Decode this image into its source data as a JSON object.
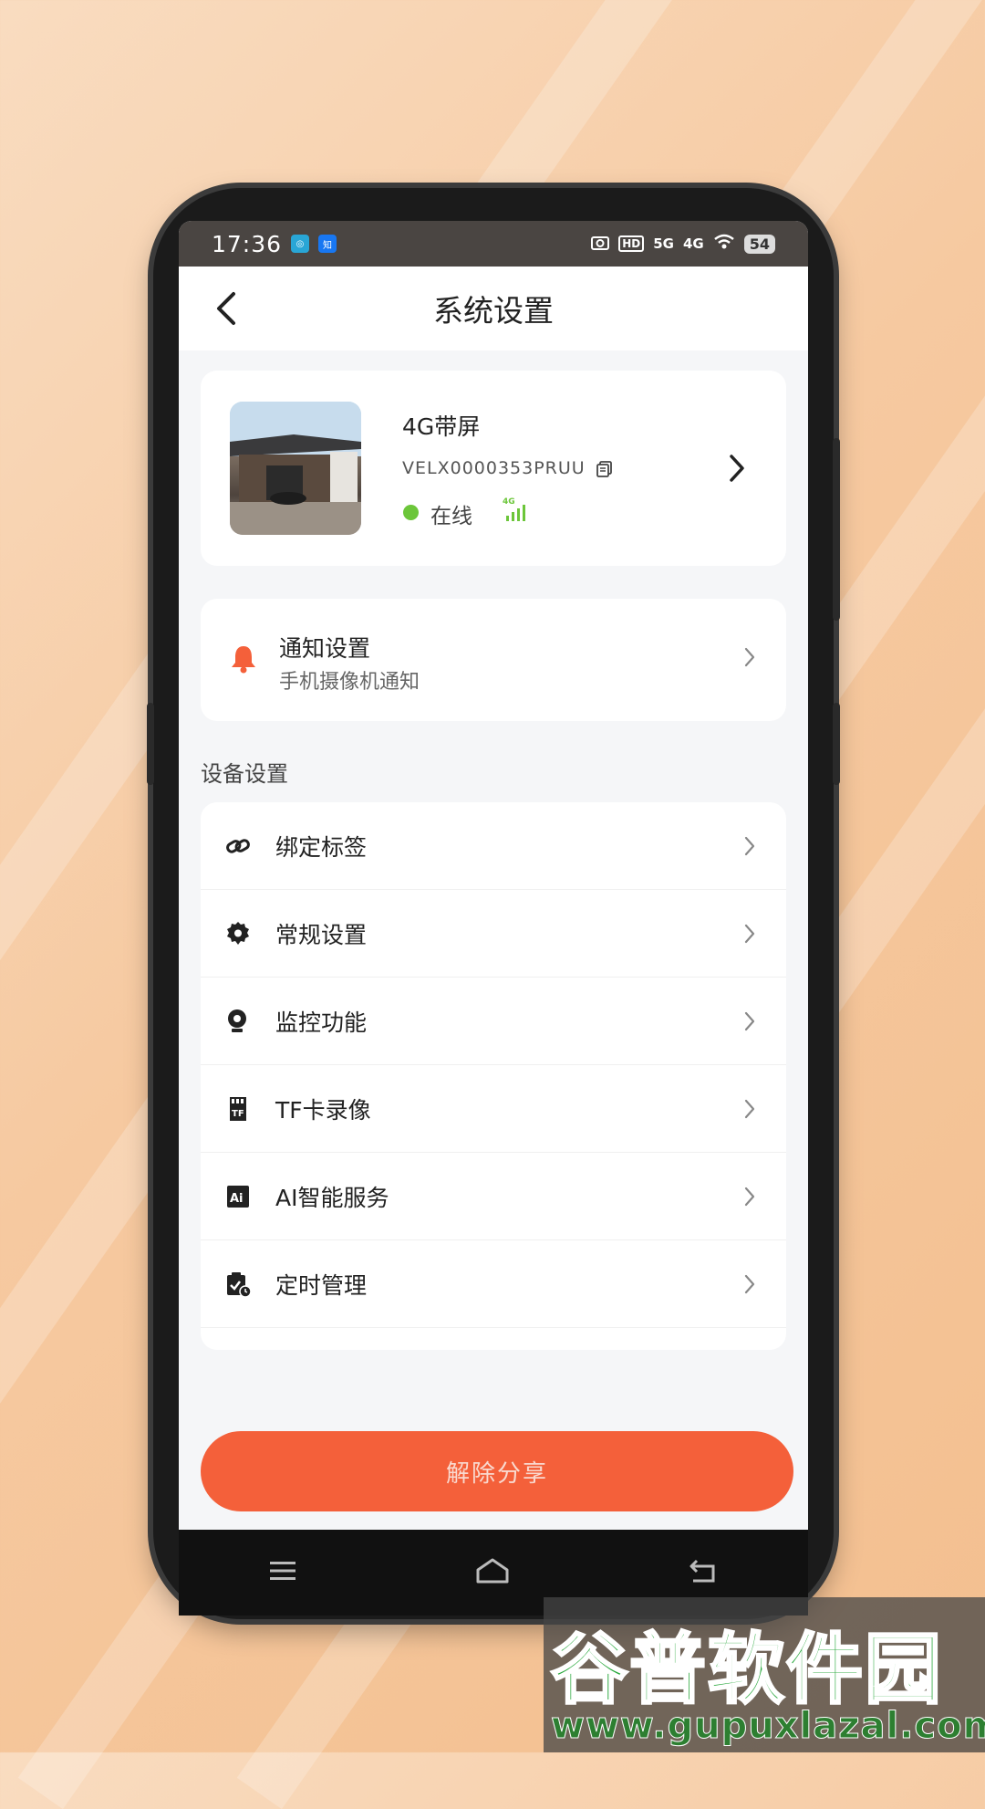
{
  "status_bar": {
    "time": "17:36",
    "battery": "54",
    "network_5g": "5G",
    "network_4g": "4G"
  },
  "header": {
    "title": "系统设置"
  },
  "device": {
    "name": "4G带屏",
    "id": "VELX0000353PRUU",
    "status": "在线",
    "signal_label": "4G"
  },
  "notify": {
    "title": "通知设置",
    "subtitle": "手机摄像机通知"
  },
  "device_settings": {
    "section_title": "设备设置",
    "items": [
      {
        "label": "绑定标签",
        "icon": "link-icon"
      },
      {
        "label": "常规设置",
        "icon": "gear-icon"
      },
      {
        "label": "监控功能",
        "icon": "camera-icon"
      },
      {
        "label": "TF卡录像",
        "icon": "tf-card-icon"
      },
      {
        "label": "AI智能服务",
        "icon": "ai-icon"
      },
      {
        "label": "定时管理",
        "icon": "schedule-icon"
      }
    ]
  },
  "actions": {
    "unshare_label": "解除分享"
  },
  "watermark": {
    "brand": "谷普软件园",
    "url": "www.gupuxlazal.com"
  },
  "colors": {
    "accent": "#f4603a",
    "online": "#6cc63a",
    "bell": "#f4603a"
  }
}
